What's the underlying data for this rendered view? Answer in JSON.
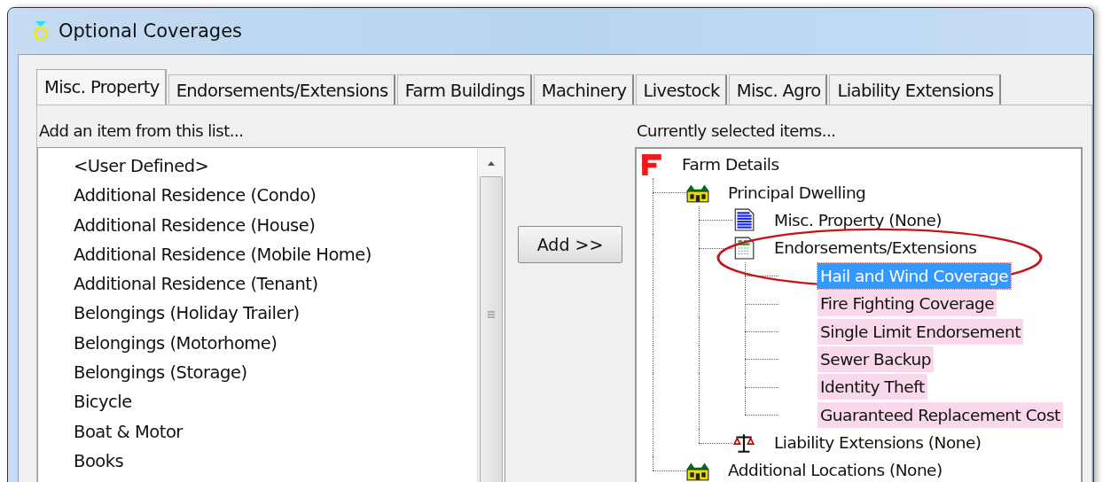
{
  "window": {
    "title": "Optional Coverages"
  },
  "tabs": [
    {
      "label": "Misc. Property",
      "selected": true
    },
    {
      "label": "Endorsements/Extensions",
      "selected": false
    },
    {
      "label": "Farm Buildings",
      "selected": false
    },
    {
      "label": "Machinery",
      "selected": false
    },
    {
      "label": "Livestock",
      "selected": false
    },
    {
      "label": "Misc. Agro",
      "selected": false
    },
    {
      "label": "Liability Extensions",
      "selected": false
    }
  ],
  "available": {
    "label": "Add an item from this list...",
    "items": [
      "<User Defined>",
      "Additional Residence (Condo)",
      "Additional Residence (House)",
      "Additional Residence (Mobile Home)",
      "Additional Residence (Tenant)",
      "Belongings (Holiday Trailer)",
      "Belongings (Motorhome)",
      "Belongings (Storage)",
      "Bicycle",
      "Boat & Motor",
      "Books"
    ]
  },
  "add_button": "Add >>",
  "selected_items": {
    "label": "Currently selected items...",
    "tree": [
      {
        "label": "Farm Details",
        "kind": "farm",
        "selected": false,
        "highlighted": false,
        "children": [
          {
            "label": "Principal Dwelling",
            "kind": "house",
            "selected": false,
            "highlighted": false,
            "children": [
              {
                "label": "Misc. Property (None)",
                "kind": "list",
                "selected": false,
                "highlighted": false
              },
              {
                "label": "Endorsements/Extensions",
                "kind": "form",
                "selected": false,
                "highlighted": false,
                "children": [
                  {
                    "label": "Hail and Wind Coverage",
                    "selected": true,
                    "highlighted": true
                  },
                  {
                    "label": "Fire Fighting Coverage",
                    "selected": false,
                    "highlighted": true
                  },
                  {
                    "label": "Single Limit Endorsement",
                    "selected": false,
                    "highlighted": true
                  },
                  {
                    "label": "Sewer Backup",
                    "selected": false,
                    "highlighted": true
                  },
                  {
                    "label": "Identity Theft",
                    "selected": false,
                    "highlighted": true
                  },
                  {
                    "label": "Guaranteed Replacement Cost",
                    "selected": false,
                    "highlighted": true
                  }
                ]
              },
              {
                "label": "Liability Extensions (None)",
                "kind": "scales",
                "selected": false,
                "highlighted": false
              }
            ]
          },
          {
            "label": "Additional Locations (None)",
            "kind": "house",
            "selected": false,
            "highlighted": false
          }
        ]
      }
    ]
  }
}
